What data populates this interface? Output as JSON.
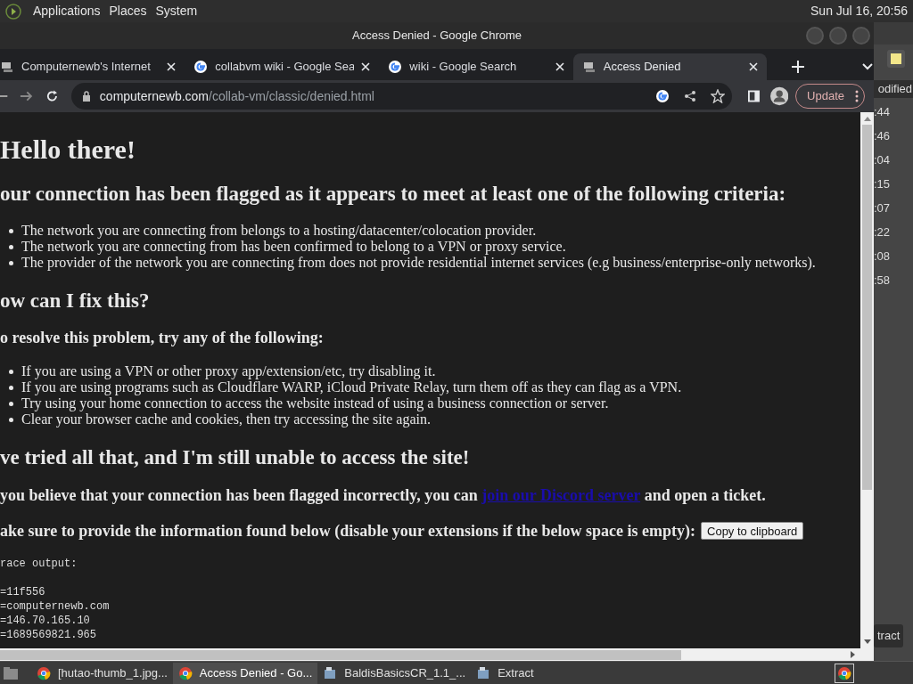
{
  "top_panel": {
    "menus": [
      "Applications",
      "Places",
      "System"
    ],
    "clock": "Sun Jul 16, 20:56"
  },
  "window": {
    "title": "Access Denied - Google Chrome"
  },
  "tabs": [
    {
      "label": "Computernewb's Internet",
      "kind": "site",
      "selected": false
    },
    {
      "label": "collabvm wiki - Google Sea",
      "kind": "search",
      "selected": false
    },
    {
      "label": "wiki - Google Search",
      "kind": "search",
      "selected": false
    },
    {
      "label": "Access Denied",
      "kind": "site",
      "selected": true
    }
  ],
  "address_bar": {
    "domain": "computernewb.com",
    "path": "/collab-vm/classic/denied.html",
    "update_button": "Update"
  },
  "page": {
    "title": "Hello there!",
    "criteria_heading": "our connection has been flagged as it appears to meet at least one of the following criteria:",
    "criteria": [
      "The network you are connecting from belongs to a hosting/datacenter/colocation provider.",
      "The network you are connecting from has been confirmed to belong to a VPN or proxy service.",
      "The provider of the network you are connecting from does not provide residential internet services (e.g business/enterprise-only networks)."
    ],
    "fix_heading": "ow can I fix this?",
    "fix_subheading": "o resolve this problem, try any of the following:",
    "fixes": [
      "If you are using a VPN or other proxy app/extension/etc, try disabling it.",
      "If you are using programs such as Cloudflare WARP, iCloud Private Relay, turn them off as they can flag as a VPN.",
      "Try using your home connection to access the website instead of using a business connection or server.",
      "Clear your browser cache and cookies, then try accessing the site again."
    ],
    "still_heading": "ve tried all that, and I'm still unable to access the site!",
    "contact": {
      "before": "you believe that your connection has been flagged incorrectly, you can",
      "link": "join our Discord server",
      "after": "and open a ticket."
    },
    "provide_text": "ake sure to provide the information found below (disable your extensions if the below space is empty):",
    "copy_button": "Copy to clipboard",
    "trace_label": "race output:",
    "trace_lines": [
      "=11f556",
      "=computernewb.com",
      "=146.70.165.10",
      "=1689569821.965"
    ]
  },
  "background_window": {
    "column_heading": "odified",
    "times": [
      ":44",
      ":46",
      ":04",
      ":15",
      ":07",
      ":22",
      ":08",
      ":58"
    ],
    "button": "tract"
  },
  "taskbar": [
    {
      "label": "[hutao-thumb_1.jpg...",
      "kind": "browser",
      "selected": false
    },
    {
      "label": "Access Denied - Go...",
      "kind": "browser",
      "selected": true
    },
    {
      "label": "BaldisBasicsCR_1.1_...",
      "kind": "archiver",
      "selected": false
    },
    {
      "label": "Extract",
      "kind": "archiver",
      "selected": false
    }
  ]
}
